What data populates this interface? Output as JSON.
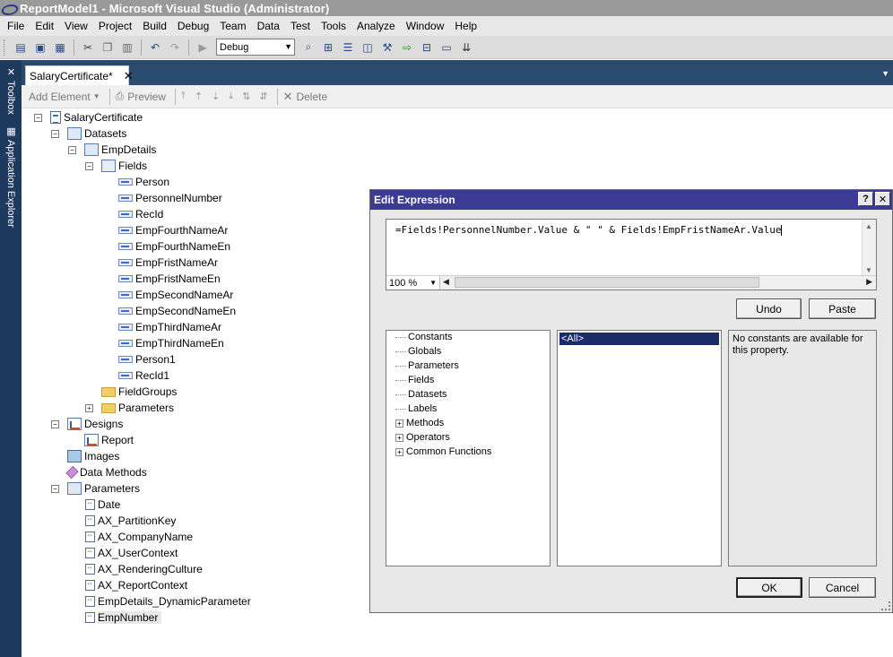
{
  "window": {
    "title": "ReportModel1 - Microsoft Visual Studio (Administrator)"
  },
  "menu": [
    "File",
    "Edit",
    "View",
    "Project",
    "Build",
    "Debug",
    "Team",
    "Data",
    "Test",
    "Tools",
    "Analyze",
    "Window",
    "Help"
  ],
  "toolbar": {
    "config_value": "Debug"
  },
  "left_dock": {
    "toolbox": "Toolbox",
    "app_explorer": "Application Explorer"
  },
  "doc_tab": {
    "label": "SalaryCertificate*",
    "close": "✕"
  },
  "designer_toolbar": {
    "add_element": "Add Element",
    "preview": "Preview",
    "delete": "Delete"
  },
  "tree": {
    "root": "SalaryCertificate",
    "datasets": "Datasets",
    "empdetails": "EmpDetails",
    "fields": "Fields",
    "field_items": [
      "Person",
      "PersonnelNumber",
      "RecId",
      "EmpFourthNameAr",
      "EmpFourthNameEn",
      "EmpFristNameAr",
      "EmpFristNameEn",
      "EmpSecondNameAr",
      "EmpSecondNameEn",
      "EmpThirdNameAr",
      "EmpThirdNameEn",
      "Person1",
      "RecId1"
    ],
    "fieldgroups": "FieldGroups",
    "ds_parameters": "Parameters",
    "designs": "Designs",
    "report": "Report",
    "images": "Images",
    "data_methods": "Data Methods",
    "parameters": "Parameters",
    "param_items": [
      "Date",
      "AX_PartitionKey",
      "AX_CompanyName",
      "AX_UserContext",
      "AX_RenderingCulture",
      "AX_ReportContext",
      "EmpDetails_DynamicParameter",
      "EmpNumber"
    ]
  },
  "dialog": {
    "title": "Edit Expression",
    "help_btn": "?",
    "close_btn": "✕",
    "expression": "=Fields!PersonnelNumber.Value & \" \" & Fields!EmpFristNameAr.Value",
    "zoom": "100 %",
    "undo": "Undo",
    "paste": "Paste",
    "categories": [
      "Constants",
      "Globals",
      "Parameters",
      "Fields",
      "Datasets",
      "Labels",
      "Methods",
      "Operators",
      "Common Functions"
    ],
    "list_selected": "<All>",
    "description": "No constants are available for this property.",
    "ok": "OK",
    "cancel": "Cancel"
  }
}
